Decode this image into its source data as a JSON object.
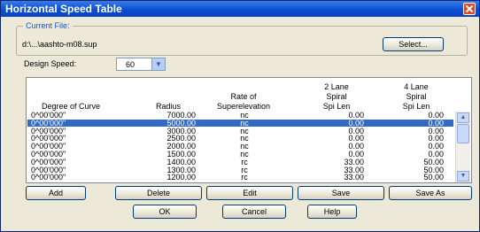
{
  "window": {
    "title": "Horizontal Speed Table"
  },
  "current_file": {
    "label": "Current File:",
    "path": "d:\\...\\aashto-m08.sup",
    "select_label": "Select..."
  },
  "design_speed": {
    "label": "Design Speed:",
    "value": "60"
  },
  "table": {
    "headers": {
      "degree": "Degree of Curve",
      "radius": "Radius",
      "rate_1": "Rate of",
      "rate_2": "Superelevation",
      "l2_1": "2 Lane",
      "l2_2": "Spiral",
      "l2_3": "Spi Len",
      "l4_1": "4 Lane",
      "l4_2": "Spiral",
      "l4_3": "Spi Len"
    },
    "rows": [
      {
        "degree": "0^00'000\"",
        "radius": "7000.00",
        "rate": "nc",
        "spi2": "0.00",
        "spi4": "0.00"
      },
      {
        "degree": "0^00'000\"",
        "radius": "5000.00",
        "rate": "nc",
        "spi2": "0.00",
        "spi4": "0.00"
      },
      {
        "degree": "0^00'000\"",
        "radius": "3000.00",
        "rate": "nc",
        "spi2": "0.00",
        "spi4": "0.00"
      },
      {
        "degree": "0^00'000\"",
        "radius": "2500.00",
        "rate": "nc",
        "spi2": "0.00",
        "spi4": "0.00"
      },
      {
        "degree": "0^00'000\"",
        "radius": "2000.00",
        "rate": "nc",
        "spi2": "0.00",
        "spi4": "0.00"
      },
      {
        "degree": "0^00'000\"",
        "radius": "1500.00",
        "rate": "nc",
        "spi2": "0.00",
        "spi4": "0.00"
      },
      {
        "degree": "0^00'000\"",
        "radius": "1400.00",
        "rate": "rc",
        "spi2": "33.00",
        "spi4": "50.00"
      },
      {
        "degree": "0^00'000\"",
        "radius": "1300.00",
        "rate": "rc",
        "spi2": "33.00",
        "spi4": "50.00"
      },
      {
        "degree": "0^00'000\"",
        "radius": "1200.00",
        "rate": "rc",
        "spi2": "33.00",
        "spi4": "50.00"
      }
    ],
    "selected_row": 1
  },
  "buttons": {
    "add": "Add",
    "delete": "Delete",
    "edit": "Edit",
    "save": "Save",
    "save_as": "Save As",
    "ok": "OK",
    "cancel": "Cancel",
    "help": "Help"
  }
}
